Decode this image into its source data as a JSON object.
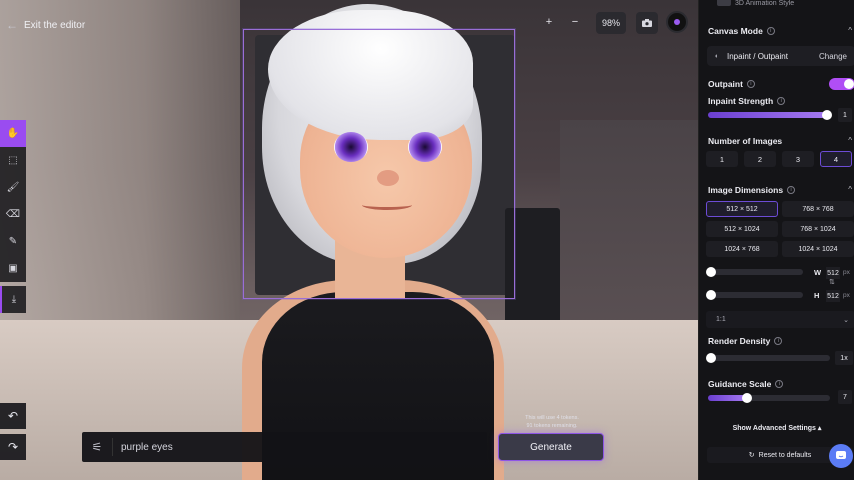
{
  "topbar": {
    "exit_label": "Exit the editor",
    "zoom_in": "+",
    "zoom_out": "−",
    "zoom_level": "98%"
  },
  "panel": {
    "header_text": "3D Animation Style",
    "canvas_mode": {
      "title": "Canvas Mode",
      "value": "Inpaint / Outpaint",
      "change_label": "Change"
    },
    "outpaint": {
      "label": "Outpaint",
      "enabled": true
    },
    "inpaint_strength": {
      "label": "Inpaint Strength",
      "value": "1",
      "fraction": 0.98
    },
    "num_images": {
      "title": "Number of Images",
      "options": [
        "1",
        "2",
        "3",
        "4"
      ],
      "selected": "4"
    },
    "dimensions": {
      "title": "Image Dimensions",
      "options": [
        "512 × 512",
        "768 × 768",
        "512 × 1024",
        "768 × 1024",
        "1024 × 768",
        "1024 × 1024"
      ],
      "selected": "512 × 512",
      "width_label": "W",
      "width_value": "512",
      "height_label": "H",
      "height_value": "512",
      "unit": "px",
      "aspect_ratio": "1:1"
    },
    "render_density": {
      "title": "Render Density",
      "value": "1x",
      "fraction": 0.0
    },
    "guidance_scale": {
      "title": "Guidance Scale",
      "value": "7",
      "fraction": 0.32
    },
    "advanced_label": "Show Advanced Settings ▴",
    "reset_label": "Reset to defaults"
  },
  "prompt": {
    "text": "purple eyes",
    "token_note_line1": "This will use 4 tokens.",
    "token_note_line2": "91 tokens remaining.",
    "generate_label": "Generate"
  },
  "colors": {
    "accent": "#9a4cf0",
    "toggle_on": "#b04ef5",
    "panel_bg": "#141417"
  }
}
